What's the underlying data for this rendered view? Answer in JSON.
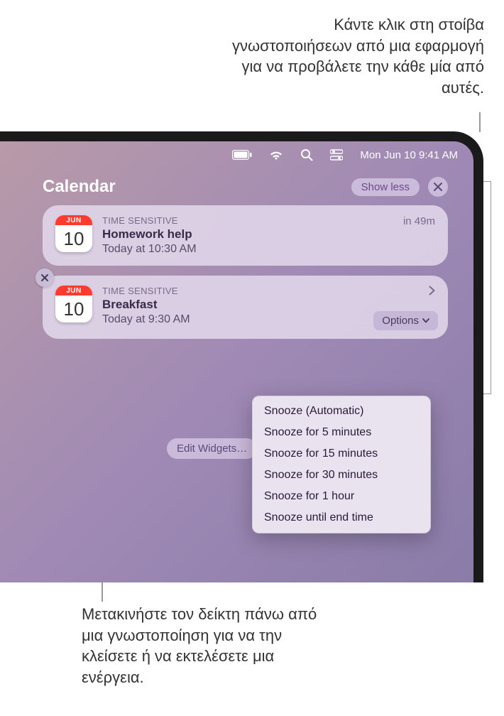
{
  "callouts": {
    "top": "Κάντε κλικ στη στοίβα γνωστοποιήσεων από μια εφαρμογή για να προβάλετε την κάθε μία από αυτές.",
    "bottom": "Μετακινήστε τον δείκτη πάνω από μια γνωστοποίηση για να την κλείσετε ή να εκτελέσετε μια ενέργεια."
  },
  "menubar": {
    "date_time": "Mon Jun 10  9:41 AM"
  },
  "notifications": {
    "app_title": "Calendar",
    "show_less": "Show less",
    "items": [
      {
        "month": "JUN",
        "day": "10",
        "label": "TIME SENSITIVE",
        "title": "Homework help",
        "when": "Today at 10:30 AM",
        "eta": "in 49m"
      },
      {
        "month": "JUN",
        "day": "10",
        "label": "TIME SENSITIVE",
        "title": "Breakfast",
        "when": "Today at 9:30 AM"
      }
    ],
    "options_label": "Options",
    "options_menu": [
      "Snooze (Automatic)",
      "Snooze for 5 minutes",
      "Snooze for 15 minutes",
      "Snooze for 30 minutes",
      "Snooze for 1 hour",
      "Snooze until end time"
    ],
    "edit_widgets": "Edit Widgets…"
  }
}
